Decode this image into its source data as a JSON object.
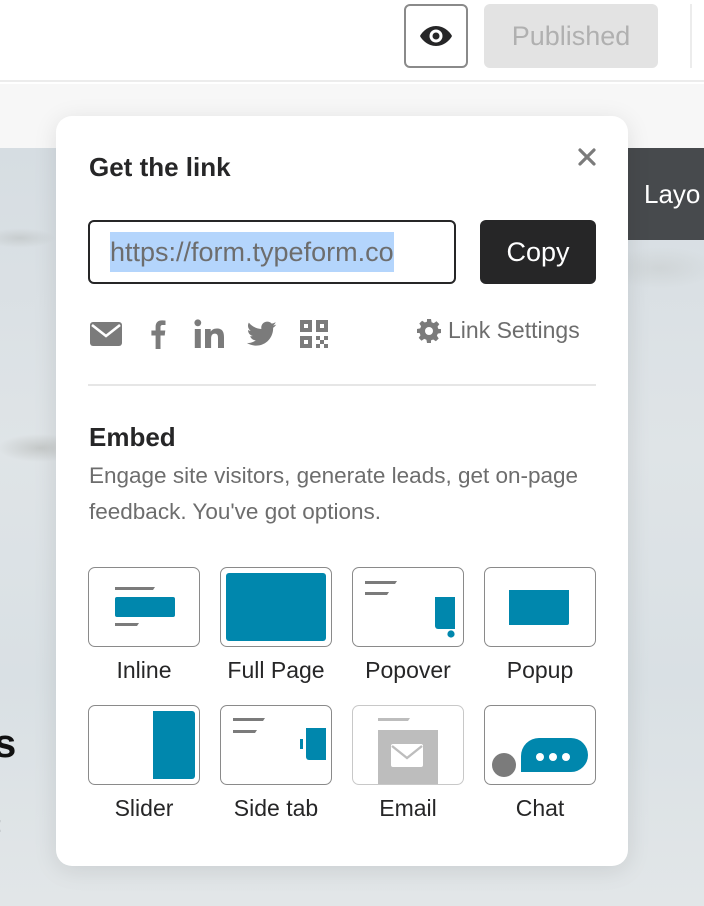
{
  "topbar": {
    "preview_icon": "eye-icon",
    "published_label": "Published"
  },
  "canvas": {
    "layout_tab_label": "Layo",
    "heading_fragment": "s",
    "text_fragment": ":"
  },
  "panel": {
    "title": "Get the link",
    "close_icon": "close-icon",
    "link": {
      "value": "https://form.typeform.co",
      "selected": true
    },
    "copy_label": "Copy",
    "share_icons": [
      "email-icon",
      "facebook-icon",
      "linkedin-icon",
      "twitter-icon",
      "qr-code-icon"
    ],
    "link_settings": {
      "icon": "gear-icon",
      "label": "Link Settings"
    },
    "embed": {
      "title": "Embed",
      "description": "Engage site visitors, generate leads, get on-page feedback. You've got options.",
      "options": [
        {
          "label": "Inline",
          "icon": "inline-embed-icon",
          "enabled": true
        },
        {
          "label": "Full Page",
          "icon": "full-page-embed-icon",
          "enabled": true
        },
        {
          "label": "Popover",
          "icon": "popover-embed-icon",
          "enabled": true
        },
        {
          "label": "Popup",
          "icon": "popup-embed-icon",
          "enabled": true
        },
        {
          "label": "Slider",
          "icon": "slider-embed-icon",
          "enabled": true
        },
        {
          "label": "Side tab",
          "icon": "side-tab-embed-icon",
          "enabled": true
        },
        {
          "label": "Email",
          "icon": "email-embed-icon",
          "enabled": false
        },
        {
          "label": "Chat",
          "icon": "chat-embed-icon",
          "enabled": true
        }
      ]
    }
  },
  "colors": {
    "accent": "#0087ad",
    "dark": "#262627",
    "muted_text": "#6d6d6d",
    "icon_gray": "#7b7b7b",
    "selection": "#b4d5fc",
    "published_bg": "#e3e3e3",
    "published_text": "#b0b0b0"
  }
}
